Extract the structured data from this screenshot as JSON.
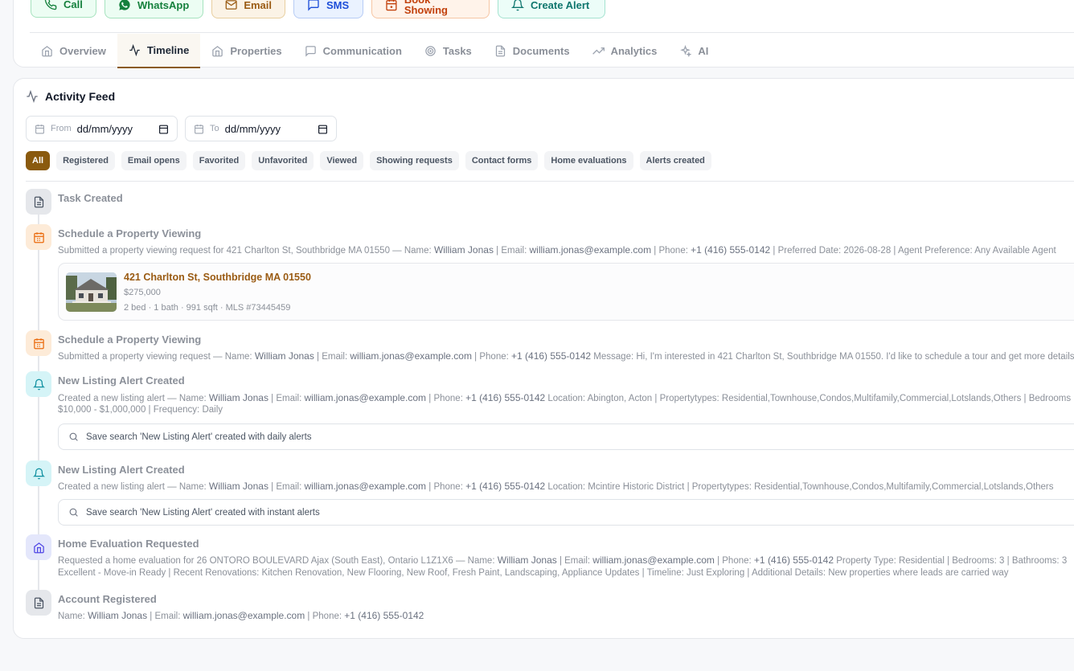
{
  "actions": {
    "call": "Call",
    "whatsapp": "WhatsApp",
    "email": "Email",
    "sms": "SMS",
    "book_showing": "Book Showing",
    "create_alert": "Create Alert"
  },
  "tabs": [
    {
      "label": "Overview",
      "icon": "home-icon"
    },
    {
      "label": "Timeline",
      "icon": "activity-icon",
      "active": true
    },
    {
      "label": "Properties",
      "icon": "home-icon"
    },
    {
      "label": "Communication",
      "icon": "message-icon"
    },
    {
      "label": "Tasks",
      "icon": "target-icon"
    },
    {
      "label": "Documents",
      "icon": "document-icon"
    },
    {
      "label": "Analytics",
      "icon": "trending-icon"
    },
    {
      "label": "AI",
      "icon": "sparkles-icon"
    }
  ],
  "feed": {
    "title": "Activity Feed",
    "from_label": "From",
    "to_label": "To",
    "date_placeholder": "dd/mm/yyyy",
    "filters": [
      "All",
      "Registered",
      "Email opens",
      "Favorited",
      "Unfavorited",
      "Viewed",
      "Showing requests",
      "Contact forms",
      "Home evaluations",
      "Alerts created"
    ]
  },
  "events": {
    "e1": {
      "title": "Task Created"
    },
    "e2": {
      "title": "Schedule a Property Viewing",
      "d1": "Submitted a property viewing request for 421 Charlton St, Southbridge MA 01550 — Name:",
      "name": "William Jonas",
      "d2": "| Email:",
      "email": "william.jonas@example.com",
      "d3": "| Phone:",
      "phone": "+1 (416) 555-0142",
      "d4": "| Preferred Date: 2026-08-28 | Agent Preference: Any Available Agent"
    },
    "property": {
      "address": "421 Charlton St, Southbridge MA 01550",
      "price": "$275,000",
      "meta": "2 bed · 1 bath · 991 sqft · MLS #73445459"
    },
    "e3": {
      "title": "Schedule a Property Viewing",
      "d1": "Submitted a property viewing request — Name:",
      "name": "William Jonas",
      "d2": "| Email:",
      "email": "william.jonas@example.com",
      "d3": "| Phone:",
      "phone": "+1 (416) 555-0142",
      "d4": "Message: Hi, I'm interested in 421 Charlton St, Southbridge MA 01550. I'd like to schedule a tour and get more details"
    },
    "e4": {
      "title": "New Listing Alert Created",
      "d1": "Created a new listing alert — Name:",
      "name": "William Jonas",
      "d2": "| Email:",
      "email": "william.jonas@example.com",
      "d3": "| Phone:",
      "phone": "+1 (416) 555-0142",
      "d4": "Location: Abington, Acton | Propertytypes: Residential,Townhouse,Condos,Multifamily,Commercial,Lotslands,Others | Bedrooms",
      "d5": "$10,000 - $1,000,000 | Frequency: Daily",
      "search": "Save search 'New Listing Alert' created with daily alerts"
    },
    "e5": {
      "title": "New Listing Alert Created",
      "d1": "Created a new listing alert — Name:",
      "name": "William Jonas",
      "d2": "| Email:",
      "email": "william.jonas@example.com",
      "d3": "| Phone:",
      "phone": "+1 (416) 555-0142",
      "d4": "Location: Mcintire Historic District | Propertytypes: Residential,Townhouse,Condos,Multifamily,Commercial,Lotslands,Others",
      "search": "Save search 'New Listing Alert' created with instant alerts"
    },
    "e6": {
      "title": "Home Evaluation Requested",
      "d1": "Requested a home evaluation for 26 ONTORO BOULEVARD Ajax (South East), Ontario L1Z1X6 — Name:",
      "name": "William Jonas",
      "d2": "| Email:",
      "email": "william.jonas@example.com",
      "d3": "| Phone:",
      "phone": "+1 (416) 555-0142",
      "d4": "Property Type: Residential | Bedrooms: 3 | Bathrooms: 3",
      "d5": "Excellent - Move-in Ready | Recent Renovations: Kitchen Renovation, New Flooring, New Roof, Fresh Paint, Landscaping, Appliance Updates | Timeline: Just Exploring | Additional Details: New properties where leads are carried way"
    },
    "e7": {
      "title": "Account Registered",
      "d1": "Name:",
      "name": "William Jonas",
      "d2": "| Email:",
      "email": "william.jonas@example.com",
      "d3": "| Phone:",
      "phone": "+1 (416) 555-0142"
    }
  }
}
